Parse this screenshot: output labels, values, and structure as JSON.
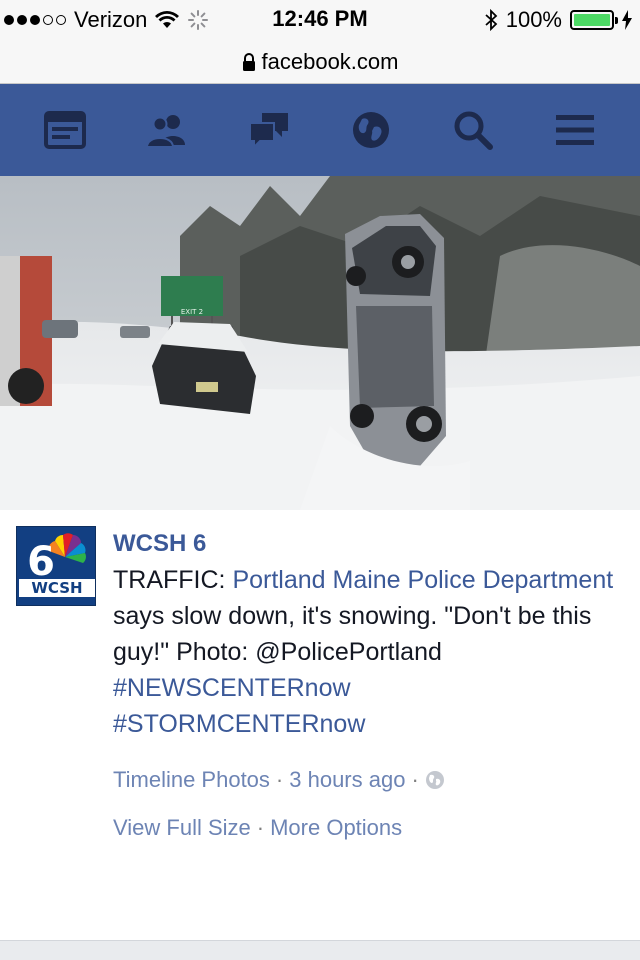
{
  "status_bar": {
    "carrier": "Verizon",
    "time": "12:46 PM",
    "battery": "100%",
    "battery_level": 1.0,
    "signal_bars_filled": 3,
    "signal_bars_total": 5
  },
  "address_bar": {
    "url": "facebook.com"
  },
  "nav": {
    "color": "#3b5998",
    "icons": [
      "news-feed-icon",
      "friend-requests-icon",
      "messages-icon",
      "notifications-globe-icon",
      "search-icon",
      "menu-icon"
    ]
  },
  "photo": {
    "sign_text": "EXIT 2"
  },
  "post": {
    "avatar_text": "WCSH",
    "avatar_number": "6",
    "page_name": "WCSH 6",
    "text_prefix": "TRAFFIC: ",
    "text_link": "Portland Maine Police Department",
    "text_body": " says slow down, it's snowing. \"Don't be this guy!\" Photo: @PolicePortland",
    "hashtag_1": "#NEWSCENTERnow",
    "hashtag_2": "#STORMCENTERnow",
    "meta_album": "Timeline Photos",
    "meta_sep": "·",
    "meta_time": "3 hours ago",
    "action_view": "View Full Size",
    "action_more": "More Options"
  }
}
